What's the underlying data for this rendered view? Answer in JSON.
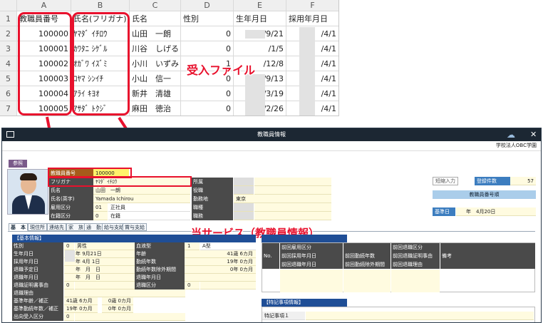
{
  "spreadsheet": {
    "col_letters": [
      "A",
      "B",
      "C",
      "D",
      "E",
      "F"
    ],
    "row_numbers": [
      "1",
      "2",
      "3",
      "4",
      "5",
      "6",
      "7"
    ],
    "headers": [
      "教職員番号",
      "氏名(フリガナ)",
      "氏名",
      "性別",
      "生年月日",
      "採用年月日"
    ],
    "rows": [
      {
        "id": "100000",
        "kana": "ﾔﾏﾀﾞ ｲﾁﾛｳ",
        "name": "山田　一朗",
        "gender": "0",
        "birth": "/9/21",
        "hire": "/4/1"
      },
      {
        "id": "100001",
        "kana": "ｶﾜﾀﾆ ｼｹﾞﾙ",
        "name": "川谷　しげる",
        "gender": "0",
        "birth": "/1/5",
        "hire": "/4/1"
      },
      {
        "id": "100002",
        "kana": "ｵｶﾞﾜ ｲｽﾞﾐ",
        "name": "小川　いずみ",
        "gender": "1",
        "birth": "/12/8",
        "hire": "/4/1"
      },
      {
        "id": "100003",
        "kana": "ｺﾔﾏ ｼﾝｲﾁ",
        "name": "小山　信一",
        "gender": "0",
        "birth": "/9/13",
        "hire": "/4/1"
      },
      {
        "id": "100004",
        "kana": "ｱﾗｲ ｷﾖｵ",
        "name": "新井　清雄",
        "gender": "0",
        "birth": "/3/19",
        "hire": "/4/1"
      },
      {
        "id": "100005",
        "kana": "ｱｻﾀﾞ ﾄｸｼﾞ",
        "name": "麻田　徳治",
        "gender": "0",
        "birth": "/2/26",
        "hire": "/4/1"
      }
    ]
  },
  "callouts": {
    "import_file": "受入ファイル",
    "service": "当サービス（教職員情報）"
  },
  "app": {
    "title": "教職員情報",
    "org": "学校法人OBC学園",
    "ref_label": "参照",
    "fields": {
      "emp_no_label": "教職員番号",
      "emp_no": "100000",
      "kana_label": "フリガナ",
      "kana": "ﾔﾏﾀﾞ ｲﾁﾛｳ",
      "name_label": "氏名",
      "name": "山田　一朗",
      "name_en_label": "氏名(英字)",
      "name_en": "Yamada Ichirou",
      "emp_type_label": "雇用区分",
      "emp_type_code": "01",
      "emp_type": "正社員",
      "status_label": "在籍区分",
      "status_code": "0",
      "status": "在籍",
      "affil_label": "所属",
      "role_label": "役職",
      "workplace_label": "勤務地",
      "workplace": "東京",
      "type_label": "職種",
      "grade_label": "職務"
    },
    "shortcut_label": "短縮入力",
    "reg_count_label": "登録件数",
    "reg_count": "57",
    "order_label": "教職員番号順",
    "base_date_label": "基準日",
    "base_date": "年　4月20日",
    "tabs": [
      "基　本",
      "現住所",
      "連絡先",
      "家　族",
      "通　勤",
      "給与支給",
      "賞与支給"
    ],
    "basic": {
      "section": "【基本情報】",
      "rows": [
        {
          "l": "性別",
          "c": "0",
          "v": "男性"
        },
        {
          "l": "生年月日",
          "v": "年 9月21日"
        },
        {
          "l": "採用年月日",
          "v": "年 4月 1日"
        },
        {
          "l": "退職予定日",
          "v": "年　月　日"
        },
        {
          "l": "退職年月日",
          "v": "年　月　日"
        },
        {
          "l": "退職証明書事由",
          "c": "0"
        },
        {
          "l": "退職理由"
        },
        {
          "l": "基準年齢／補正",
          "v": "41歳 6カ月",
          "v2": "0歳 0カ月"
        },
        {
          "l": "基準勤続年数／補正",
          "v": "19年 0カ月",
          "v2": "0年 0カ月"
        },
        {
          "l": "出向受入区分",
          "c": "0"
        }
      ],
      "right": [
        {
          "l": "血液型",
          "c": "1",
          "v": "A型"
        },
        {
          "l": "年齢",
          "v": "41歳 6カ月"
        },
        {
          "l": "勤続年数",
          "v": "19年 0カ月"
        },
        {
          "l": "勤続年数除外期間",
          "v": "0年 0カ月"
        },
        {
          "l": "退職年月日"
        },
        {
          "l": "退職区分",
          "c": "0"
        }
      ]
    },
    "history": {
      "no": "No.",
      "h1": [
        "前回雇用区分",
        "前回採用年月日",
        "前回退職年月日"
      ],
      "h2": [
        "前回勤続年数",
        "前回勤続除外期間"
      ],
      "h3": [
        "前回退職区分",
        "前回退職証明事由",
        "前回退職理由"
      ],
      "remark": "備考"
    },
    "special": {
      "section": "【特記事項情報】",
      "item": "特記事項１"
    }
  }
}
